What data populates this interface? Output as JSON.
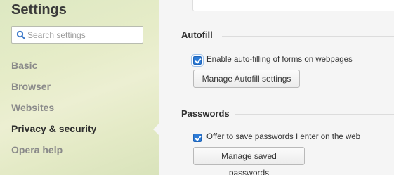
{
  "sidebar": {
    "title": "Settings",
    "search": {
      "placeholder": "Search settings",
      "value": ""
    },
    "items": [
      {
        "label": "Basic",
        "active": false
      },
      {
        "label": "Browser",
        "active": false
      },
      {
        "label": "Websites",
        "active": false
      },
      {
        "label": "Privacy & security",
        "active": true
      },
      {
        "label": "Opera help",
        "active": false
      }
    ]
  },
  "main": {
    "autofill": {
      "title": "Autofill",
      "checkbox_label": "Enable auto-filling of forms on webpages",
      "checked": true,
      "button_label": "Manage Autofill settings"
    },
    "passwords": {
      "title": "Passwords",
      "checkbox_label": "Offer to save passwords I enter on the web",
      "checked": true,
      "button_label": "Manage saved passwords"
    }
  },
  "colors": {
    "accent": "#2d7bd6",
    "sidebar_bg": "#e4eac6",
    "content_bg": "#f5f5f5"
  }
}
